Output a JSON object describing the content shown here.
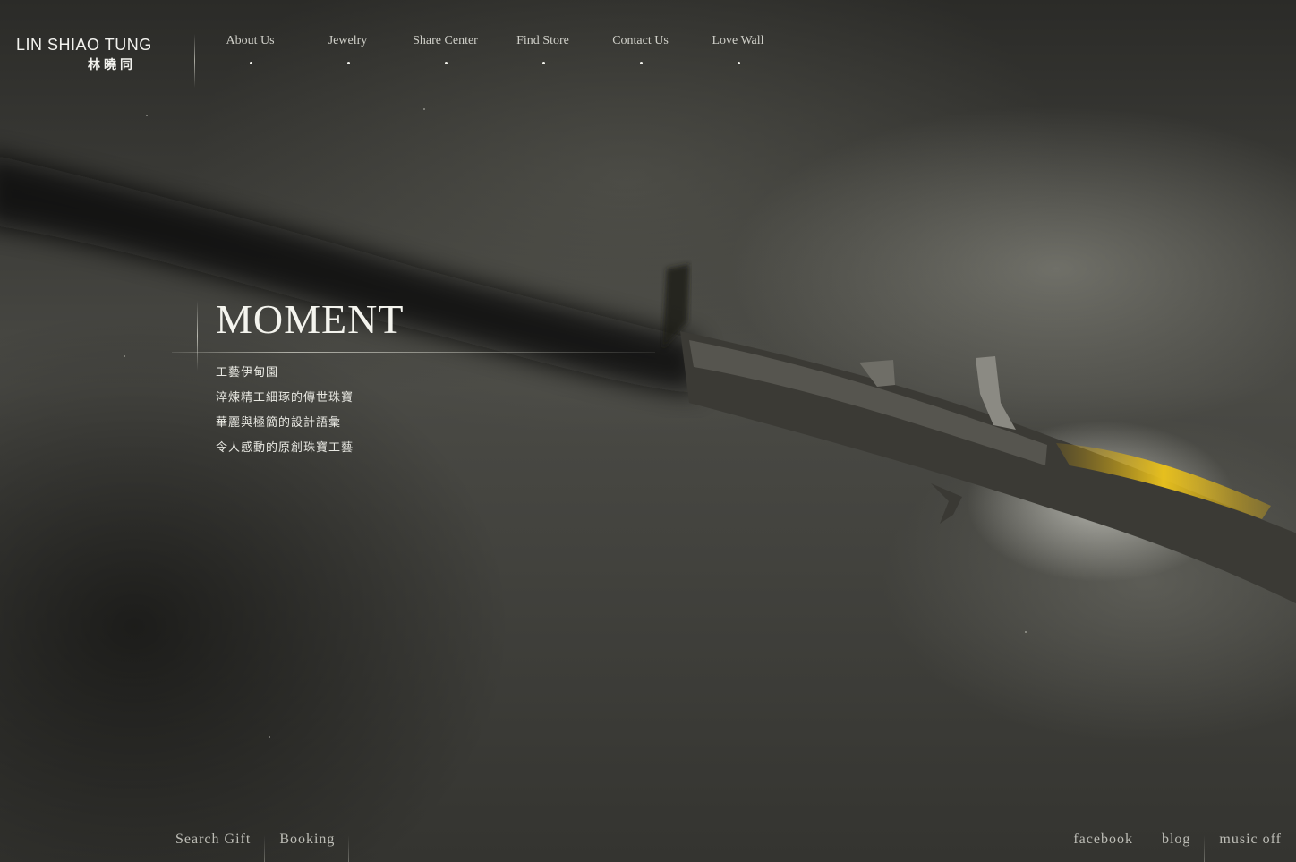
{
  "brand": {
    "name_en": "LIN SHIAO TUNG",
    "name_zh": "林曉同"
  },
  "nav": [
    {
      "label": "About Us"
    },
    {
      "label": "Jewelry"
    },
    {
      "label": "Share Center"
    },
    {
      "label": "Find Store"
    },
    {
      "label": "Contact Us"
    },
    {
      "label": "Love Wall"
    }
  ],
  "hero": {
    "title": "MOMENT",
    "lines": [
      "工藝伊甸園",
      "淬煉精工細琢的傳世珠寶",
      "華麗與極簡的設計語彙",
      "令人感動的原創珠寶工藝"
    ]
  },
  "footer_left": [
    {
      "label": "Search Gift"
    },
    {
      "label": "Booking"
    }
  ],
  "footer_right": [
    {
      "label": "facebook"
    },
    {
      "label": "blog"
    },
    {
      "label": "music off"
    }
  ],
  "colors": {
    "background": "#2a2a27",
    "accent_gold": "#d9b21a",
    "text": "#d8d8d2"
  },
  "icons": {
    "nav_marker": "dot-icon"
  }
}
